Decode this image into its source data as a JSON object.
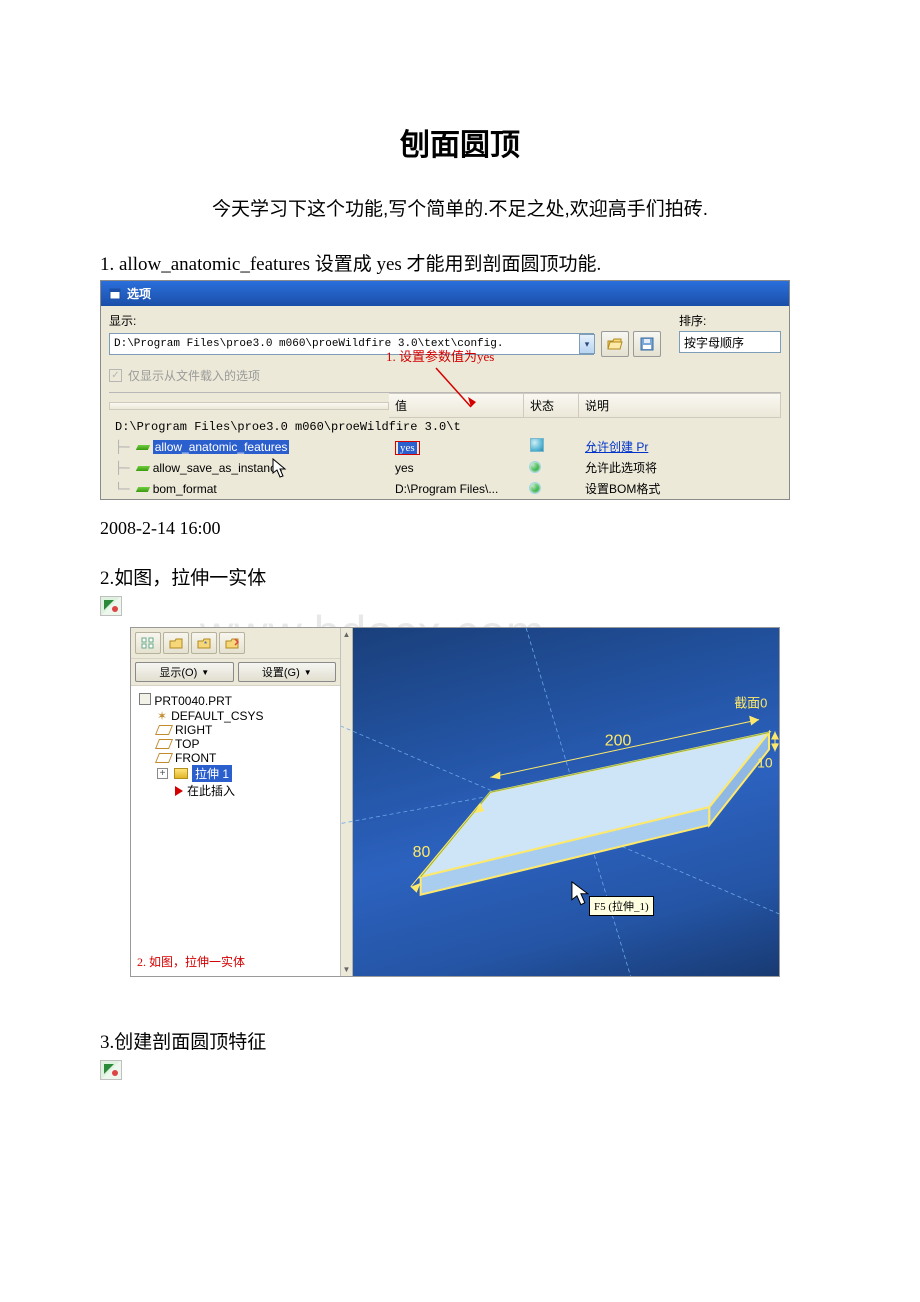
{
  "title": "刨面圆顶",
  "intro": "今天学习下这个功能,写个简单的.不足之处,欢迎高手们拍砖.",
  "watermark": "www.bdocx.com",
  "timestamp": "2008-2-14 16:00",
  "step1": "1.  allow_anatomic_features 设置成 yes 才能用到剖面圆顶功能.",
  "step2": "2.如图，拉伸一实体",
  "step3": "3.创建剖面圆顶特征",
  "fig1": {
    "window_title": "选项",
    "show_label": "显示:",
    "sort_label": "排序:",
    "sort_value": "按字母顺序",
    "config_path": "D:\\Program Files\\proe3.0 m060\\proeWildfire 3.0\\text\\config.",
    "only_loaded": "仅显示从文件载入的选项",
    "annotation": "1. 设置参数值为yes",
    "headers": {
      "name": "",
      "value": "值",
      "status": "状态",
      "desc": "说明"
    },
    "group_label": "D:\\Program Files\\proe3.0 m060\\proeWildfire 3.0\\t",
    "rows": [
      {
        "name": "allow_anatomic_features",
        "value": "yes",
        "desc": "允许创建 Pr",
        "selected": true,
        "highlight_value": true,
        "desc_link": true,
        "status": "bluebox"
      },
      {
        "name": "allow_save_as_instance",
        "value": "yes",
        "desc": "允许此选项将",
        "status": "green"
      },
      {
        "name": "bom_format",
        "value": "D:\\Program Files\\...",
        "desc": "设置BOM格式",
        "status": "green"
      }
    ]
  },
  "fig2": {
    "show_btn": "显示(O)",
    "set_btn": "设置(G)",
    "root": "PRT0040.PRT",
    "items": [
      {
        "icon": "csys",
        "label": "DEFAULT_CSYS"
      },
      {
        "icon": "plane",
        "label": "RIGHT"
      },
      {
        "icon": "plane",
        "label": "TOP"
      },
      {
        "icon": "plane",
        "label": "FRONT"
      },
      {
        "icon": "extrude",
        "label": "拉伸 1",
        "selected": true,
        "expandable": true
      },
      {
        "icon": "insert",
        "label": "在此插入",
        "child": true
      }
    ],
    "annotation": "2. 如图，拉伸一实体",
    "dims": {
      "length": "200",
      "width": "80",
      "height": "10"
    },
    "edge_label": "截面0",
    "tooltip": "F5 (拉伸_1)"
  }
}
